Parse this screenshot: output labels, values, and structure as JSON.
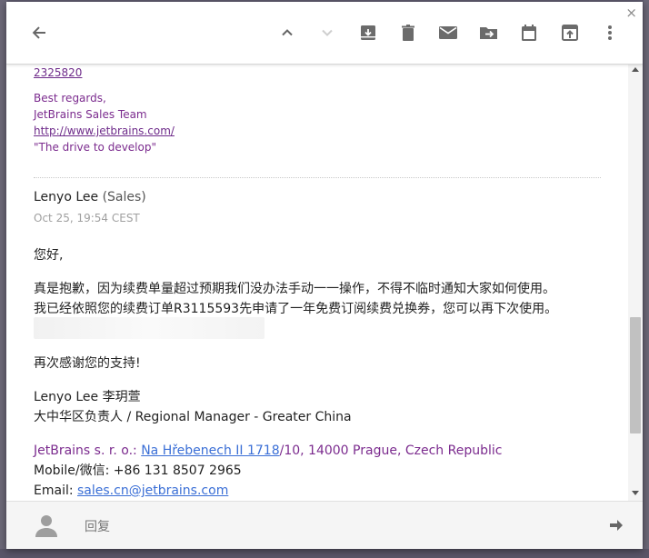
{
  "window": {
    "close_glyph": "×"
  },
  "toolbar": {
    "icons": [
      "back-arrow-icon",
      "chevron-up-icon",
      "chevron-down-icon",
      "archive-icon",
      "trash-icon",
      "mail-icon",
      "move-to-icon",
      "calendar-icon",
      "open-in-new-icon",
      "more-vert-icon"
    ]
  },
  "previous_message": {
    "phone_link": "2325820",
    "regards": "Best regards,",
    "team": "JetBrains Sales Team",
    "url": "http://www.jetbrains.com/",
    "slogan": "\"The drive to develop\""
  },
  "message": {
    "sender_name": "Lenyo Lee",
    "sender_role": "(Sales)",
    "date": "Oct 25, 19:54 CEST",
    "greeting": "您好,",
    "line1": "真是抱歉，因为续费单量超过预期我们没办法手动一一操作，不得不临时通知大家如何使用。",
    "line2": "我已经依照您的续费订单R3115593先申请了一年免费订阅续费兑换券，您可以再下次使用。",
    "thanks": "再次感谢您的支持!",
    "sig_name": "Lenyo Lee 李玥萱",
    "sig_title": "大中华区负责人 / Regional Manager - Greater China",
    "company": "JetBrains s. r. o.:",
    "address_link": "Na Hřebenech II 1718",
    "address_rest": "/10, 14000 Prague, Czech Republic",
    "mobile": "Mobile/微信: +86 131 8507 2965",
    "email_label": "Email: ",
    "email": "sales.cn@jetbrains.com"
  },
  "reply_bar": {
    "label": "回复"
  },
  "colors": {
    "accent_purple": "#7b2b8e",
    "link_blue": "#3b6fd6"
  }
}
